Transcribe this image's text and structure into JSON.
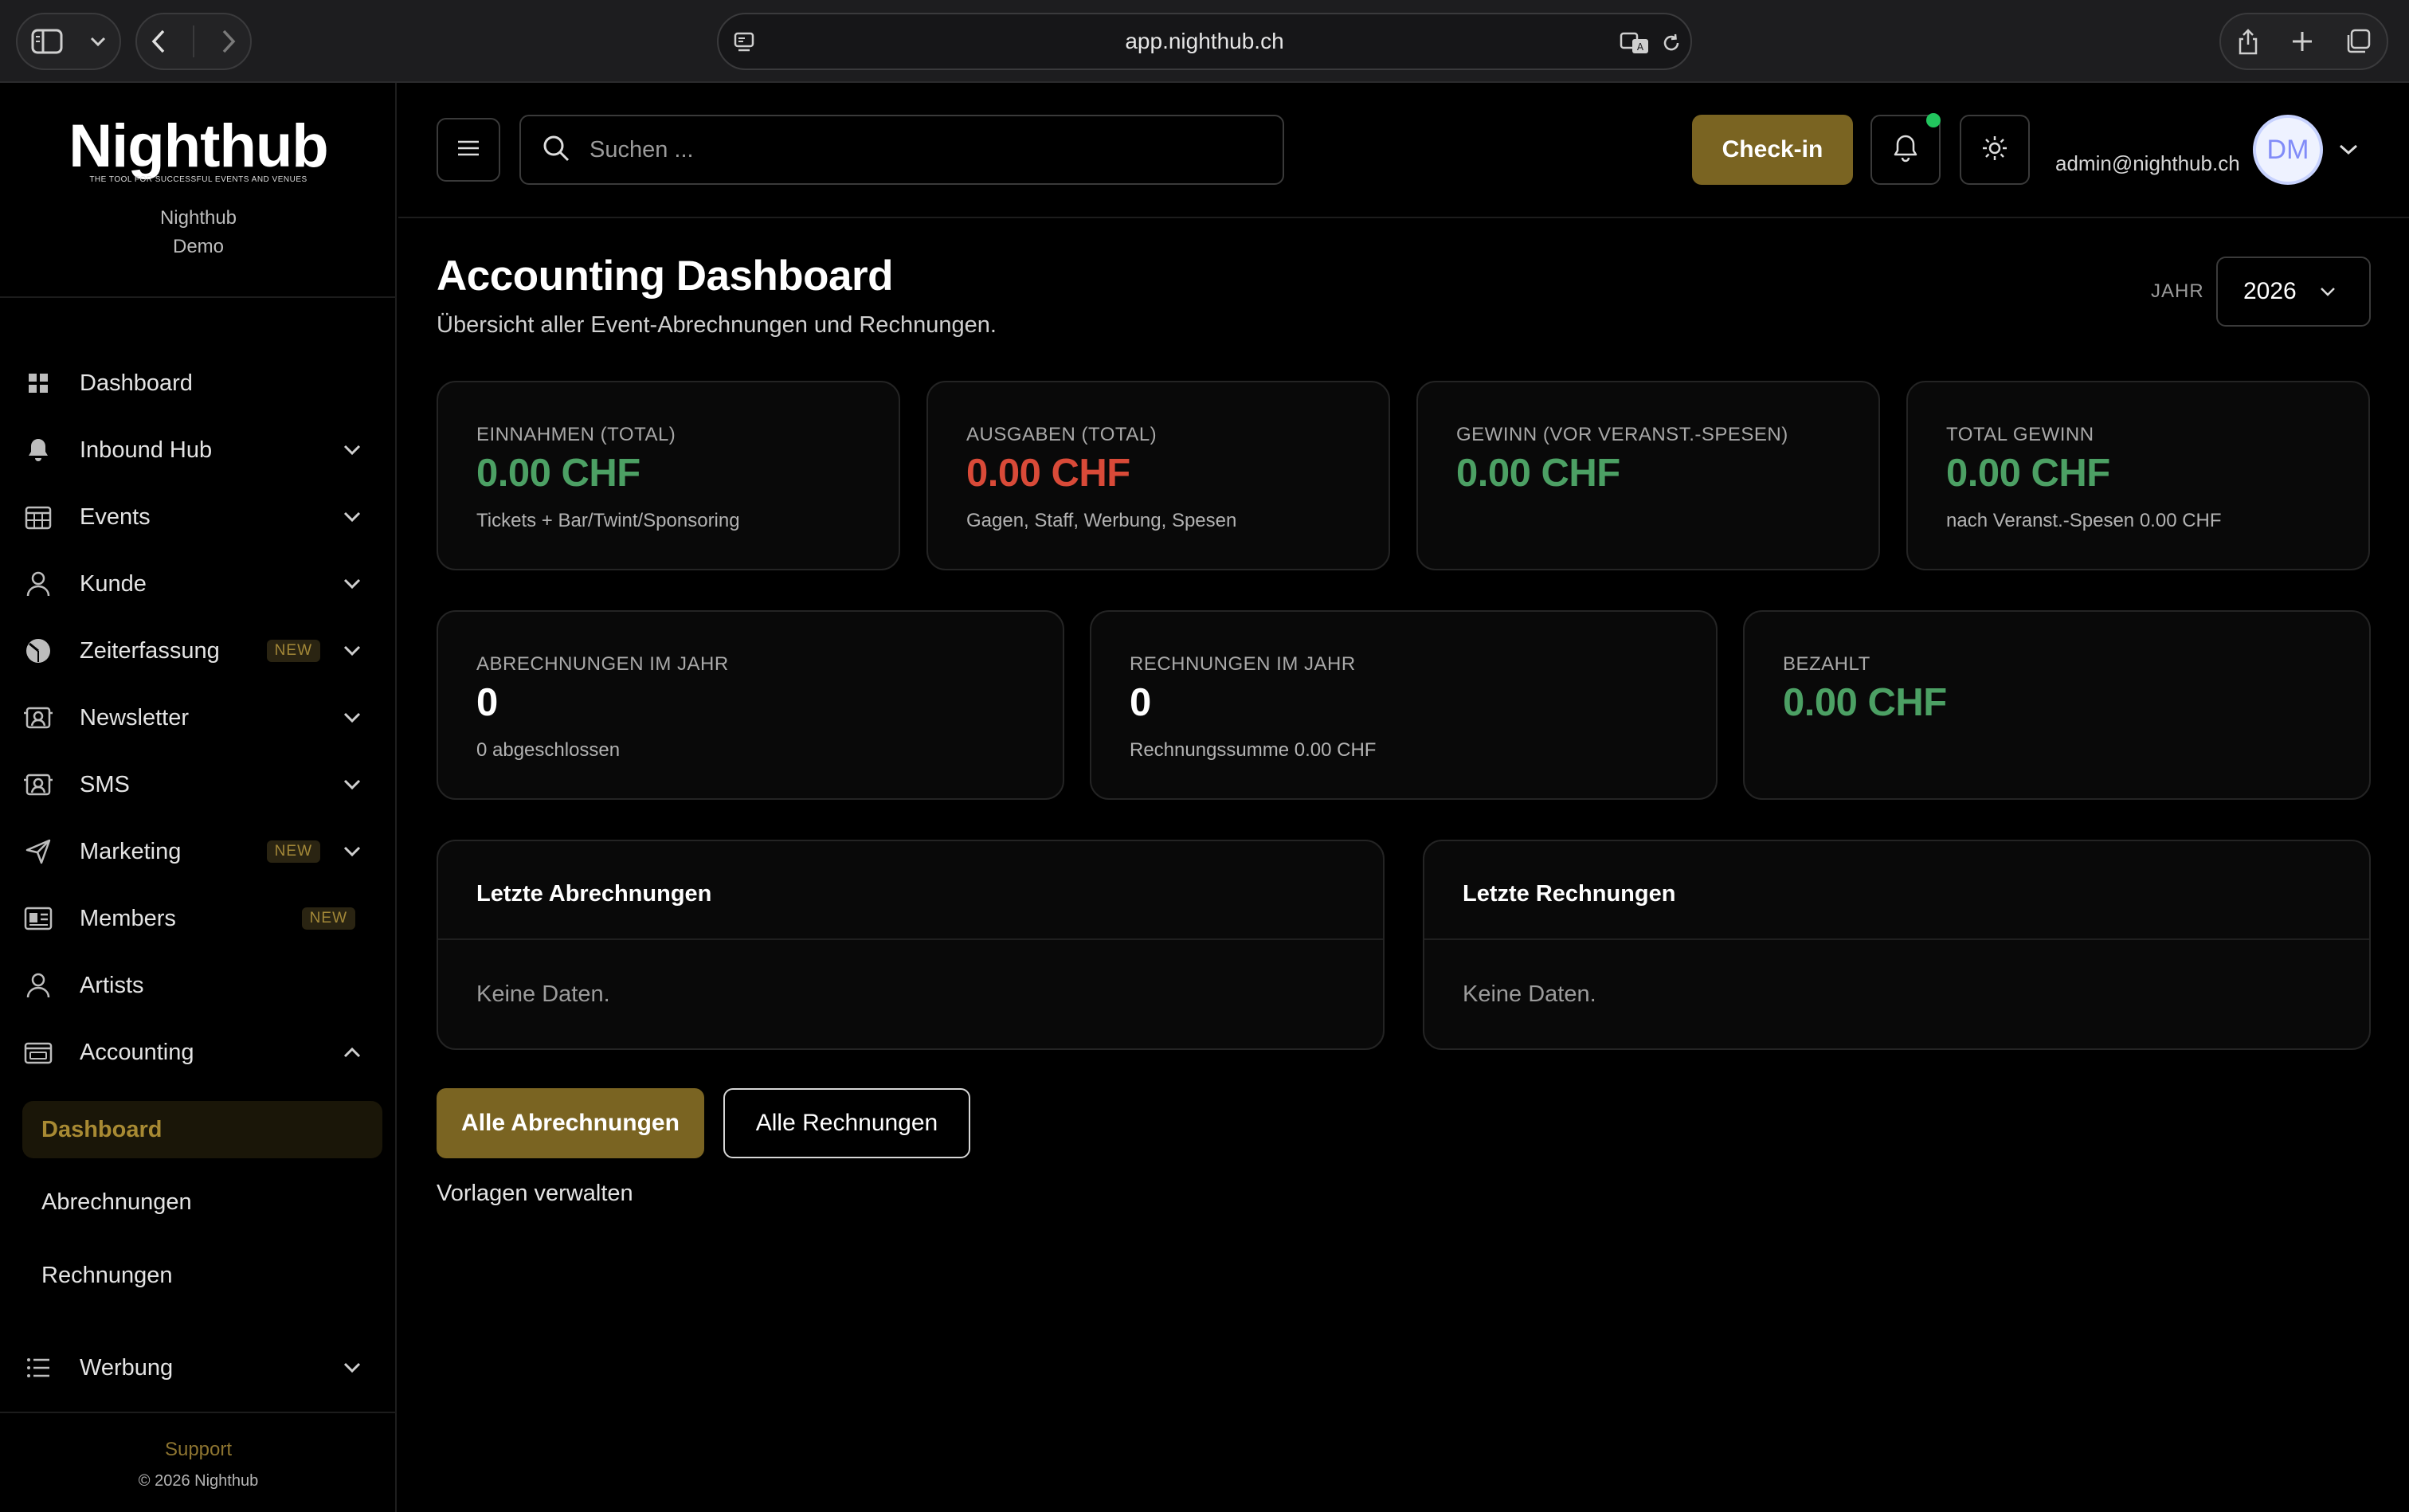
{
  "browser": {
    "url": "app.nighthub.ch"
  },
  "sidebar": {
    "logo": "Nighthub",
    "tagline": "THE TOOL FOR SUCCESSFUL EVENTS AND VENUES",
    "org_line1": "Nighthub",
    "org_line2": "Demo",
    "items": [
      {
        "label": "Dashboard",
        "icon": "grid-icon"
      },
      {
        "label": "Inbound Hub",
        "icon": "bell-icon"
      },
      {
        "label": "Events",
        "icon": "calendar-icon"
      },
      {
        "label": "Kunde",
        "icon": "user-icon"
      },
      {
        "label": "Zeiterfassung",
        "icon": "clock-icon",
        "badge": "NEW"
      },
      {
        "label": "Newsletter",
        "icon": "newsletter-icon"
      },
      {
        "label": "SMS",
        "icon": "sms-icon"
      },
      {
        "label": "Marketing",
        "icon": "send-icon",
        "badge": "NEW"
      },
      {
        "label": "Members",
        "icon": "id-card-icon",
        "badge": "NEW"
      },
      {
        "label": "Artists",
        "icon": "user-icon"
      },
      {
        "label": "Accounting",
        "icon": "wallet-icon"
      }
    ],
    "accounting_sub": [
      "Dashboard",
      "Abrechnungen",
      "Rechnungen"
    ],
    "werbung": "Werbung",
    "support": "Support",
    "copyright": "© 2026 Nighthub"
  },
  "topbar": {
    "search_placeholder": "Suchen ...",
    "checkin": "Check-in",
    "email": "admin@nighthub.ch",
    "avatar": "DM"
  },
  "main": {
    "title": "Accounting Dashboard",
    "subtitle": "Übersicht aller Event-Abrechnungen und Rechnungen.",
    "year_label": "JAHR",
    "year": "2026",
    "kpis": [
      {
        "label": "EINNAHMEN (TOTAL)",
        "value": "0.00 CHF",
        "hint": "Tickets + Bar/Twint/Sponsoring",
        "color": "#4ca064"
      },
      {
        "label": "AUSGABEN (TOTAL)",
        "value": "0.00 CHF",
        "hint": "Gagen, Staff, Werbung, Spesen",
        "color": "#d94a38"
      },
      {
        "label": "GEWINN (VOR VERANST.-SPESEN)",
        "value": "0.00 CHF",
        "hint": "",
        "color": "#4ca064"
      },
      {
        "label": "TOTAL GEWINN",
        "value": "0.00 CHF",
        "hint": "nach Veranst.-Spesen 0.00 CHF",
        "color": "#4ca064"
      }
    ],
    "stats": [
      {
        "label": "ABRECHNUNGEN IM JAHR",
        "value": "0",
        "hint": "0 abgeschlossen"
      },
      {
        "label": "RECHNUNGEN IM JAHR",
        "value": "0",
        "hint": "Rechnungssumme 0.00 CHF"
      },
      {
        "label": "BEZAHLT",
        "value": "0.00 CHF",
        "hint": ""
      }
    ],
    "panels": [
      {
        "title": "Letzte Abrechnungen",
        "empty": "Keine Daten."
      },
      {
        "title": "Letzte Rechnungen",
        "empty": "Keine Daten."
      }
    ],
    "btn_all_abrechnungen": "Alle Abrechnungen",
    "btn_all_rechnungen": "Alle Rechnungen",
    "link_vorlagen": "Vorlagen verwalten"
  }
}
